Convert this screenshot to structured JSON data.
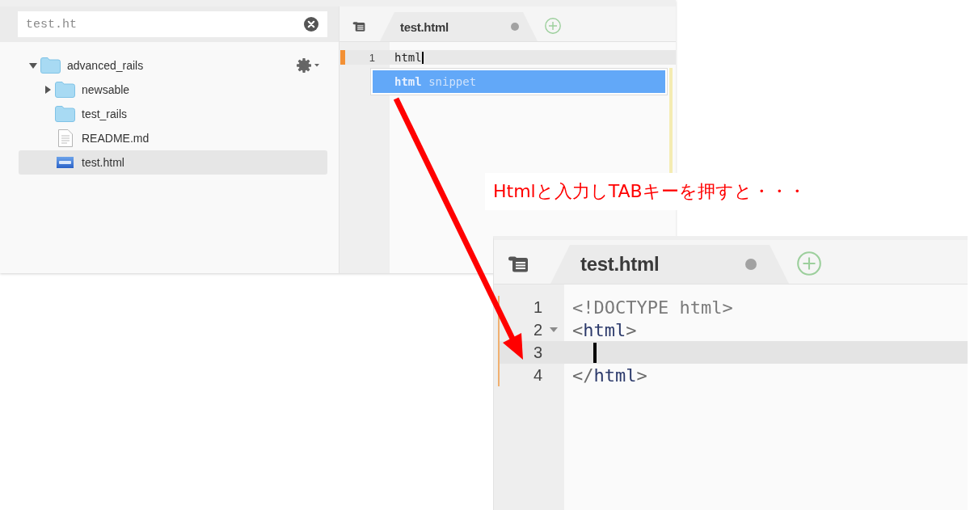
{
  "before_screen": {
    "sidebar": {
      "search": {
        "value": "test.ht"
      },
      "tree": [
        {
          "label": "advanced_rails",
          "kind": "folder",
          "expanded": true,
          "selected": false,
          "children": [
            {
              "label": "newsable",
              "kind": "folder",
              "expanded": false,
              "selected": false
            },
            {
              "label": "test_rails",
              "kind": "folder",
              "selected": false
            },
            {
              "label": "README.md",
              "kind": "file",
              "selected": false
            },
            {
              "label": "test.html",
              "kind": "html",
              "selected": true
            }
          ]
        }
      ]
    },
    "editor": {
      "tabs": [
        {
          "label": "test.html",
          "selected": true,
          "unsaved": true
        }
      ],
      "lines": [
        {
          "number": "1",
          "code": [
            {
              "text": "html",
              "kind": "plain"
            }
          ],
          "active": true,
          "changed": true,
          "cursor": true
        }
      ],
      "autocomplete": {
        "items": [
          {
            "match": "html",
            "label": "snippet",
            "selected": true
          }
        ]
      }
    }
  },
  "annotation": {
    "text": "Htmlと入力しTABキーを押すと・・・"
  },
  "after_screen": {
    "editor": {
      "tabs": [
        {
          "label": "test.html",
          "selected": true,
          "unsaved": true
        }
      ],
      "lines": [
        {
          "number": "1",
          "code": [
            {
              "text": "<!DOCTYPE html>",
              "kind": "doctype"
            }
          ],
          "active": false,
          "changed": true,
          "cursor": false,
          "foldable": false
        },
        {
          "number": "2",
          "code": [
            {
              "text": "<",
              "kind": "punct"
            },
            {
              "text": "html",
              "kind": "tag"
            },
            {
              "text": ">",
              "kind": "punct"
            }
          ],
          "active": false,
          "changed": true,
          "cursor": false,
          "foldable": true
        },
        {
          "number": "3",
          "active": true,
          "changed": true,
          "cursor": true,
          "foldable": false
        },
        {
          "number": "4",
          "code": [
            {
              "text": "</",
              "kind": "punct"
            },
            {
              "text": "html",
              "kind": "tag"
            },
            {
              "text": ">",
              "kind": "punct"
            }
          ],
          "active": false,
          "changed": true,
          "cursor": false,
          "foldable": false
        }
      ]
    }
  }
}
